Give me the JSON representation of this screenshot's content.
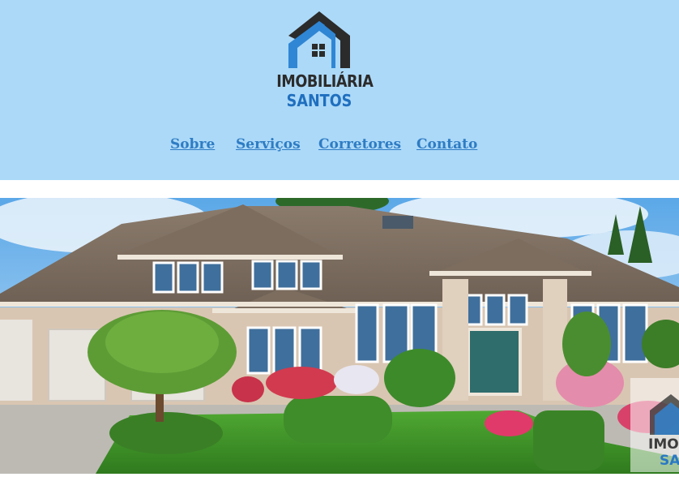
{
  "brand": {
    "line1": "IMOBILIÁRIA",
    "line2": "SANTOS",
    "colors": {
      "dark": "#2b2b2b",
      "blue": "#1f6fbf",
      "header_bg": "#acd9f8",
      "link": "#2e7cc4"
    }
  },
  "nav": {
    "items": [
      {
        "label": "Sobre"
      },
      {
        "label": "Serviços"
      },
      {
        "label": "Corretores"
      },
      {
        "label": "Contato"
      }
    ]
  },
  "hero": {
    "icon": "house-photo",
    "watermark": {
      "line1": "IMOBILIÁRIA",
      "line2": "SANTOS"
    }
  }
}
